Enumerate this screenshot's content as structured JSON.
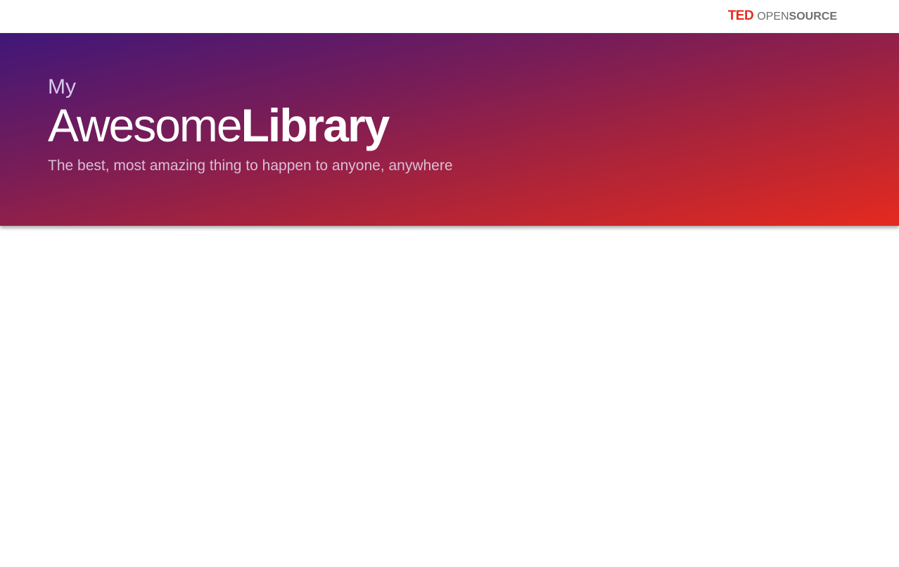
{
  "topbar": {
    "brand": {
      "ted": "TED",
      "open": "OPEN",
      "source": "SOURCE"
    }
  },
  "hero": {
    "pre_title": "My",
    "title_light": "Awesome",
    "title_bold": "Library",
    "subtitle": "The best, most amazing thing to happen to anyone, anywhere"
  },
  "colors": {
    "gradient_start": "#3f1779",
    "gradient_end": "#e52a1f",
    "brand_red": "#e62b1e"
  }
}
